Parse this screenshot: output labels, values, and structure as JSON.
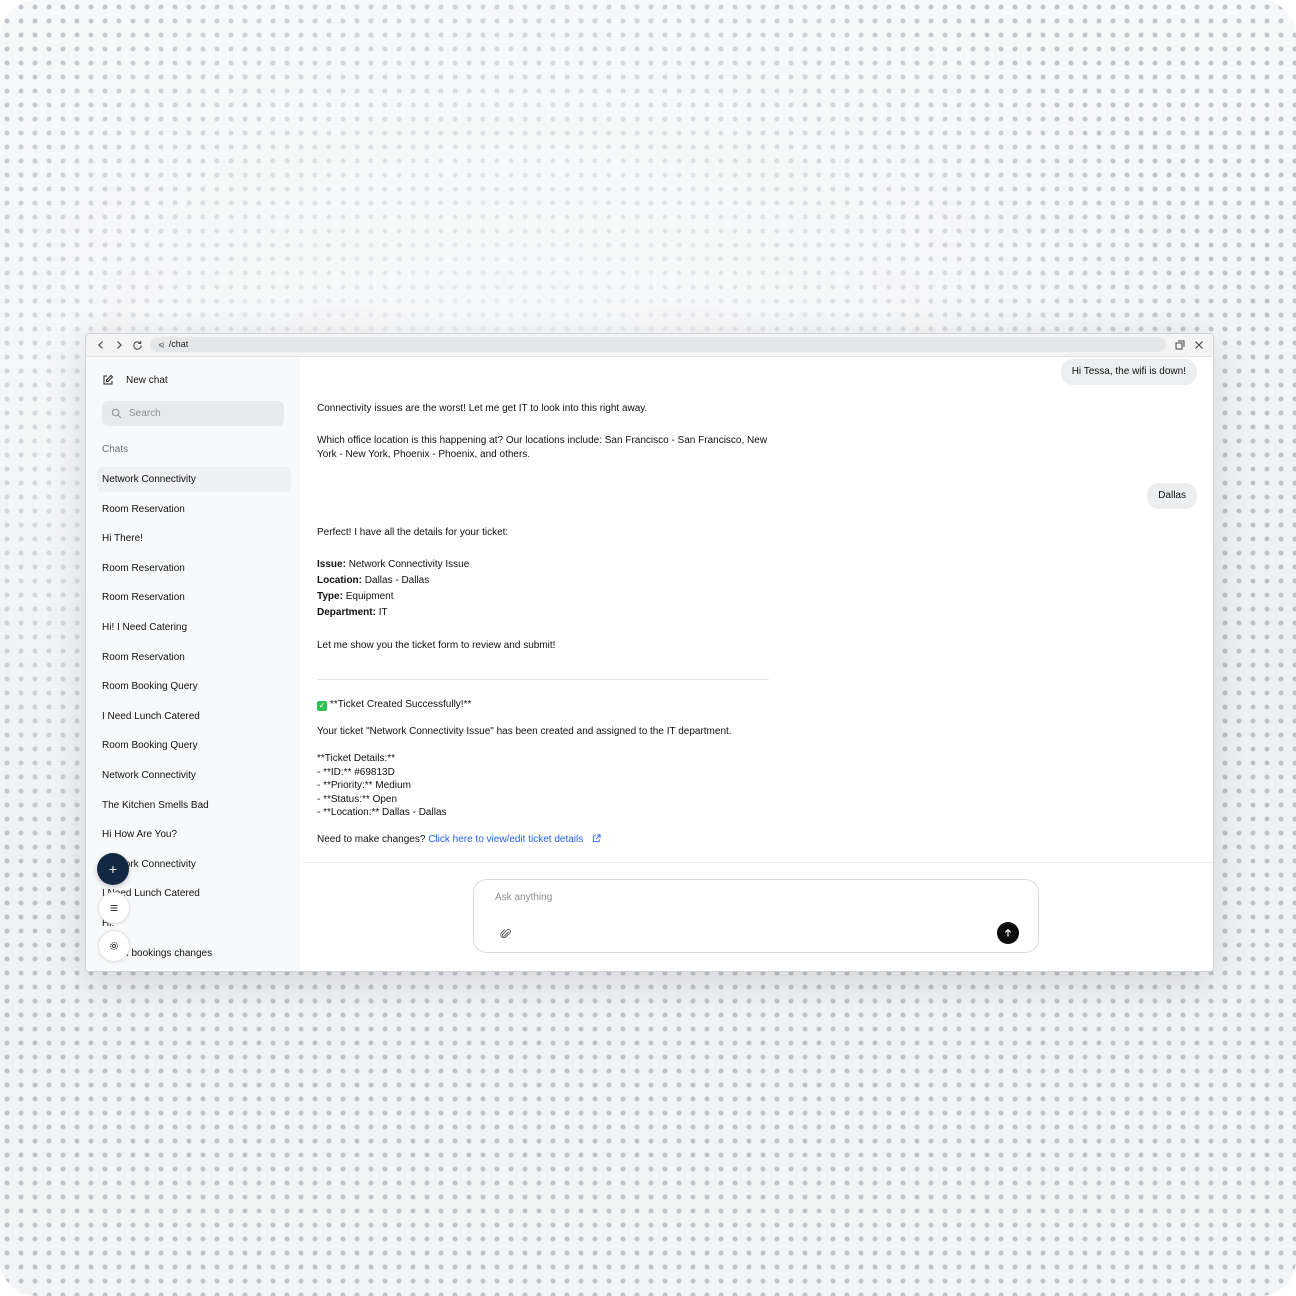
{
  "browser": {
    "url": "/chat",
    "url_prefix": "⩿"
  },
  "sidebar": {
    "new_chat_label": "New chat",
    "search_placeholder": "Search",
    "chats_heading": "Chats",
    "items": [
      "Network Connectivity",
      "Room Reservation",
      "Hi There!",
      "Room Reservation",
      "Room Reservation",
      "Hi! I Need Catering",
      "Room Reservation",
      "Room Booking Query",
      "I Need Lunch Catered",
      "Room Booking Query",
      "Network Connectivity",
      "The Kitchen Smells Bad",
      "Hi How Are You?",
      "Network Connectivity",
      "I Need Lunch Catered",
      "Hi!",
      "Room bookings changes"
    ],
    "fab_label": "+",
    "menu_icon": "menu-icon",
    "settings_icon": "gear-icon"
  },
  "conversation": {
    "user_msg_1": "Hi Tessa, the wifi is down!",
    "assistant_msg_1_p1": "Connectivity issues are the worst! Let me get IT to look into this right away.",
    "assistant_msg_1_p2": "Which office location is this happening at? Our locations include: San Francisco - San Francisco, New York - New York, Phoenix - Phoenix, and others.",
    "user_msg_2": "Dallas",
    "assistant_msg_2_intro": "Perfect! I have all the details for your ticket:",
    "ticket": {
      "issue_label": "Issue:",
      "issue_value": "Network Connectivity Issue",
      "location_label": "Location:",
      "location_value": "Dallas - Dallas",
      "type_label": "Type:",
      "type_value": "Equipment",
      "department_label": "Department:",
      "department_value": "IT"
    },
    "assistant_msg_2_outro": "Let me show you the ticket form to review and submit!",
    "success_title": "**Ticket Created Successfully!**",
    "success_body": "Your ticket \"Network Connectivity Issue\" has been created and assigned to the IT department.",
    "details_heading": "**Ticket Details:**",
    "detail_id": "- **ID:** #69813D",
    "detail_priority": "- **Priority:** Medium",
    "detail_status": "- **Status:** Open",
    "detail_location": "- **Location:** Dallas - Dallas",
    "changes_prompt": "Need to make changes?",
    "changes_link": "Click here to view/edit ticket details"
  },
  "composer": {
    "placeholder": "Ask anything"
  },
  "colors": {
    "fab": "#132843",
    "link": "#2563eb",
    "success": "#2fbf55"
  }
}
